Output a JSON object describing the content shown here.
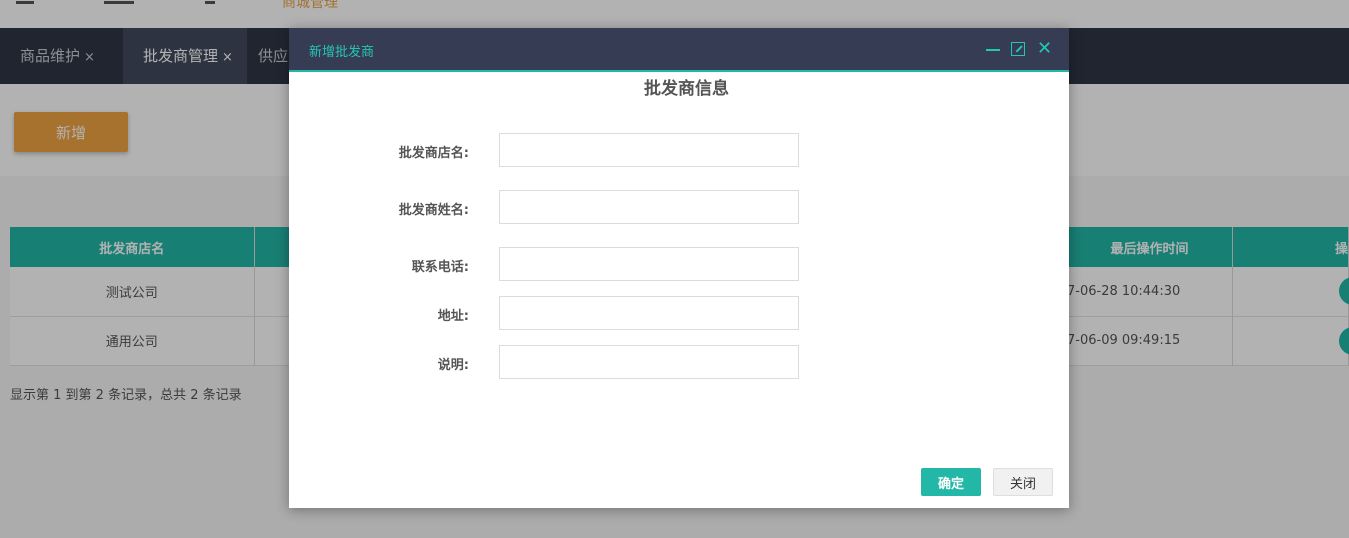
{
  "header": {
    "brand_text": "商城管理"
  },
  "tabs": [
    {
      "label": "商品维护",
      "close": "×"
    },
    {
      "label": "批发商管理",
      "close": "×"
    },
    {
      "label": "供应"
    }
  ],
  "toolbar": {
    "add_label": "新增"
  },
  "table": {
    "col_store": "批发商店名",
    "col_time": "最后操作时间",
    "col_op": "操",
    "rows": [
      {
        "store": "测试公司",
        "time": "7-06-28 10:44:30"
      },
      {
        "store": "通用公司",
        "time": "7-06-09 09:49:15"
      }
    ]
  },
  "pager": {
    "text": "显示第 1 到第 2 条记录，总共 2 条记录"
  },
  "modal": {
    "title": "新增批发商",
    "form_title": "批发商信息",
    "fields": [
      {
        "label": "批发商店名:",
        "value": ""
      },
      {
        "label": "批发商姓名:",
        "value": ""
      },
      {
        "label": "联系电话:",
        "value": ""
      },
      {
        "label": "地址:",
        "value": ""
      },
      {
        "label": "说明:",
        "value": ""
      }
    ],
    "ok_label": "确定",
    "close_label": "关闭"
  },
  "colors": {
    "accent": "#23b7a7",
    "add_button": "#f0a443",
    "tabbar": "#2f3646",
    "modal_header": "#363c54"
  },
  "icons": {
    "minimize": "minimize-icon",
    "maximize": "maximize-icon",
    "close": "close-icon"
  }
}
